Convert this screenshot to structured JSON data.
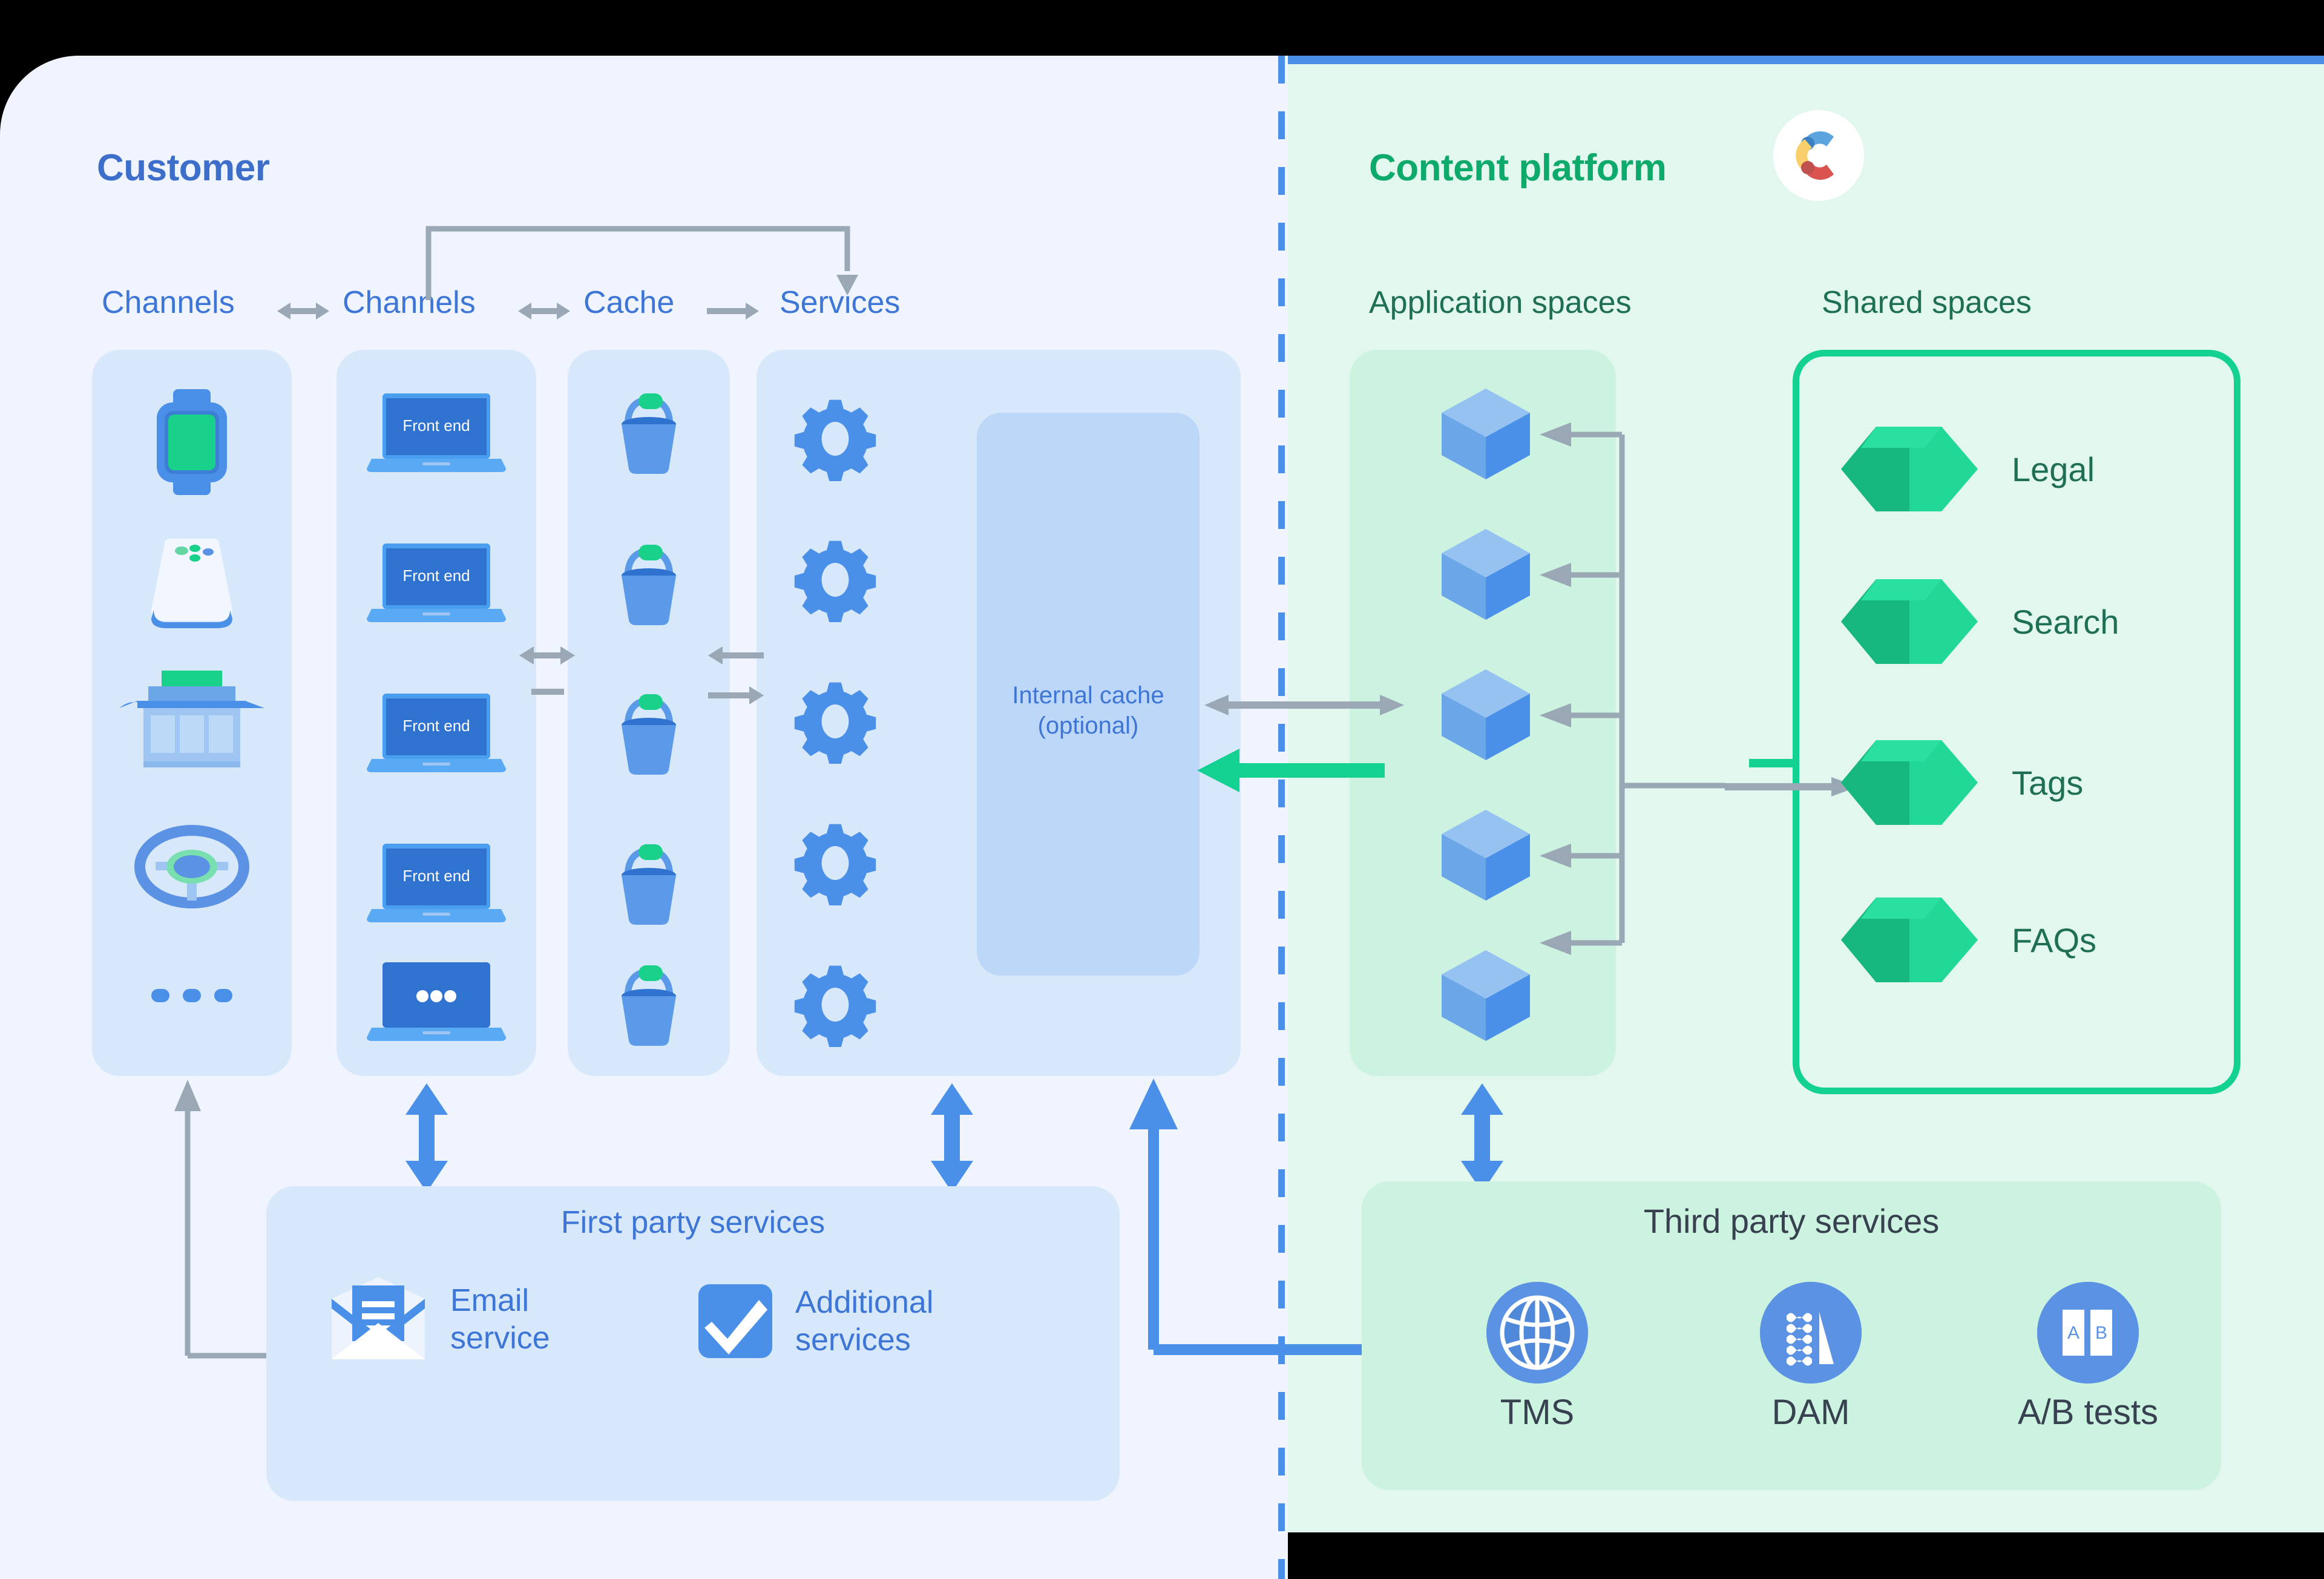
{
  "customer": {
    "title": "Customer",
    "flow": {
      "labels": [
        "Channels",
        "Channels",
        "Cache",
        "Services"
      ],
      "connectors": [
        "bidirectional-arrow",
        "bidirectional-arrow",
        "arrow-right",
        "elbow-arrow-services"
      ]
    },
    "channels_devices": [
      "smartwatch-icon",
      "smart-speaker-icon",
      "storefront-icon",
      "steering-wheel-icon",
      "ellipsis-icon"
    ],
    "frontends": [
      {
        "label": "Front end"
      },
      {
        "label": "Front end"
      },
      {
        "label": "Front end"
      },
      {
        "label": "Front end"
      },
      {
        "label": "•••"
      }
    ],
    "cache_buckets": 5,
    "services_gears": 5,
    "internal_cache": {
      "line1": "Internal cache",
      "line2": "(optional)"
    },
    "first_party": {
      "title": "First party services",
      "items": [
        {
          "label": "Email\nservice",
          "label_l1": "Email",
          "label_l2": "service",
          "icon": "envelope-icon"
        },
        {
          "label": "Additional\nservices",
          "label_l1": "Additional",
          "label_l2": "services",
          "icon": "checkmark-icon"
        }
      ]
    }
  },
  "platform": {
    "title": "Content platform",
    "logo": "contentful-logo",
    "application_spaces": {
      "label": "Application spaces",
      "count": 5,
      "icon": "cube-icon"
    },
    "shared_spaces": {
      "label": "Shared spaces",
      "items": [
        {
          "label": "Legal",
          "icon": "hexagon-prism-icon"
        },
        {
          "label": "Search",
          "icon": "hexagon-prism-icon"
        },
        {
          "label": "Tags",
          "icon": "hexagon-prism-icon"
        },
        {
          "label": "FAQs",
          "icon": "hexagon-prism-icon"
        }
      ]
    },
    "third_party": {
      "title": "Third party services",
      "items": [
        {
          "label": "TMS",
          "icon": "globe-icon"
        },
        {
          "label": "DAM",
          "icon": "media-asset-icon"
        },
        {
          "label": "A/B tests",
          "icon": "ab-test-icon",
          "a": "A",
          "b": "B"
        }
      ]
    }
  },
  "colors": {
    "customer_bg": "#eff4fe",
    "platform_bg": "#e2f8ee",
    "customer_accent": "#3d6ec9",
    "platform_accent": "#0eaa6c",
    "divider": "#4a90e9",
    "column_bg": "#d8e8fb",
    "app_space_bg": "#ccf2e0",
    "shared_border": "#13d191",
    "blue_arrow": "#4a90e9",
    "green_arrow": "#13d191",
    "gray_arrow": "#9aa7b4",
    "cube_blue": "#5b92e3",
    "hex_green": "#1fcf8f"
  }
}
